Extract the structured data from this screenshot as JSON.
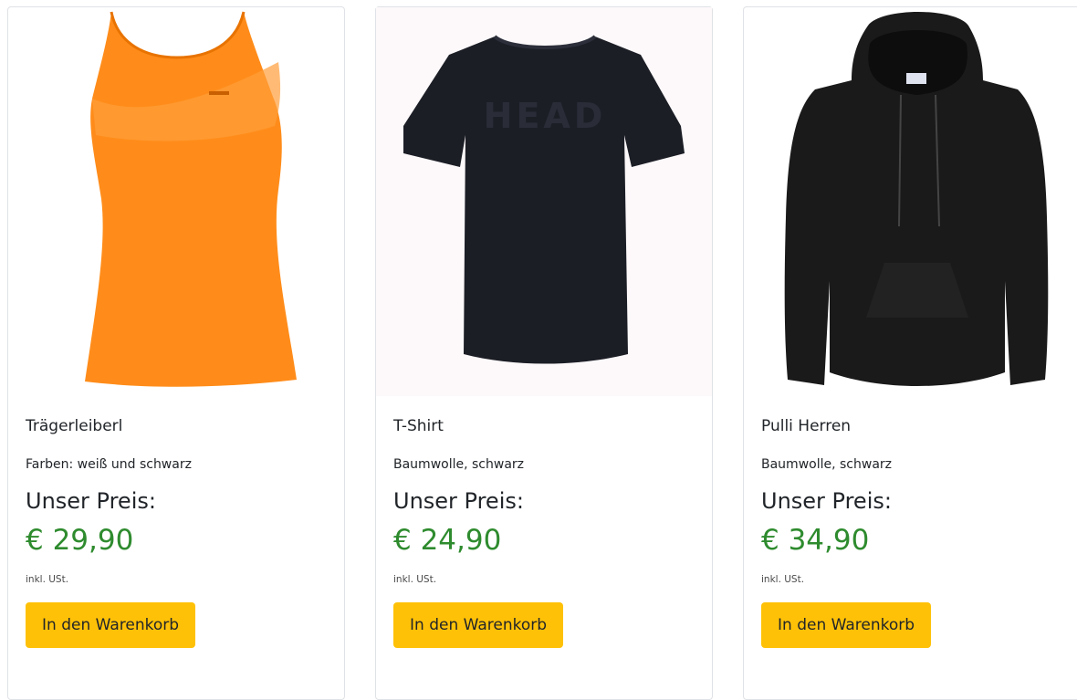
{
  "products": [
    {
      "title": "Trägerleiberl",
      "description": "Farben: weiß und schwarz",
      "price_label": "Unser Preis:",
      "price": "€ 29,90",
      "tax_note": "inkl. USt.",
      "button_label": "In den Warenkorb",
      "image_icon": "orange-tank-top",
      "image_color": "#ff8c1a"
    },
    {
      "title": "T-Shirt",
      "description": "Baumwolle, schwarz",
      "price_label": "Unser Preis:",
      "price": "€ 24,90",
      "tax_note": "inkl. USt.",
      "button_label": "In den Warenkorb",
      "image_icon": "black-t-shirt",
      "image_color": "#1c1e26",
      "image_print_text": "HEAD"
    },
    {
      "title": "Pulli Herren",
      "description": "Baumwolle, schwarz",
      "price_label": "Unser Preis:",
      "price": "€ 34,90",
      "tax_note": "inkl. USt.",
      "button_label": "In den Warenkorb",
      "image_icon": "black-hoodie",
      "image_color": "#1a1a1a"
    }
  ],
  "colors": {
    "price_green": "#2e8b2e",
    "button_yellow": "#ffc107",
    "card_border": "#dfe2e6"
  }
}
